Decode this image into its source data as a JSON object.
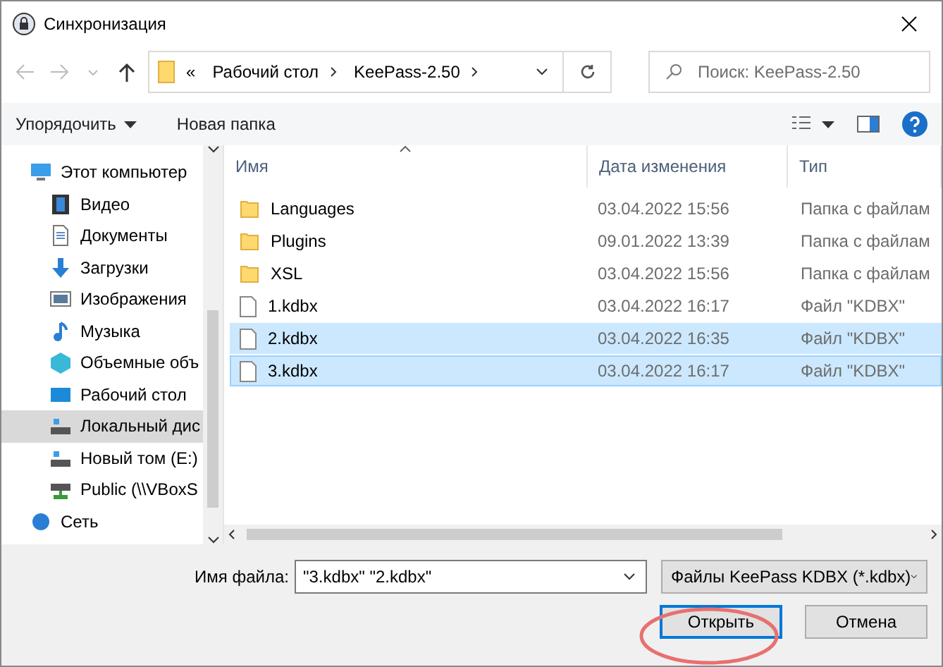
{
  "window": {
    "title": "Синхронизация"
  },
  "address": {
    "overflow": "«",
    "crumbs": [
      "Рабочий стол",
      "KeePass-2.50"
    ]
  },
  "search": {
    "placeholder": "Поиск: KeePass-2.50"
  },
  "toolbar": {
    "organize": "Упорядочить",
    "new_folder": "Новая папка"
  },
  "sidebar": {
    "items": [
      {
        "label": "Этот компьютер",
        "selected": false,
        "children": [
          {
            "label": "Видео",
            "selected": false
          },
          {
            "label": "Документы",
            "selected": false
          },
          {
            "label": "Загрузки",
            "selected": false
          },
          {
            "label": "Изображения",
            "selected": false
          },
          {
            "label": "Музыка",
            "selected": false
          },
          {
            "label": "Объемные объ",
            "selected": false
          },
          {
            "label": "Рабочий стол",
            "selected": false
          },
          {
            "label": "Локальный дис",
            "selected": true
          },
          {
            "label": "Новый том (E:)",
            "selected": false
          },
          {
            "label": "Public (\\\\VBoxS",
            "selected": false
          }
        ]
      },
      {
        "label": "Сеть",
        "selected": false
      }
    ]
  },
  "table": {
    "columns": [
      "Имя",
      "Дата изменения",
      "Тип"
    ],
    "rows": [
      {
        "name": "Languages",
        "kind": "folder",
        "date": "03.04.2022 15:56",
        "type": "Папка с файлам",
        "selected": false,
        "focused": false
      },
      {
        "name": "Plugins",
        "kind": "folder",
        "date": "09.01.2022 13:39",
        "type": "Папка с файлам",
        "selected": false,
        "focused": false
      },
      {
        "name": "XSL",
        "kind": "folder",
        "date": "03.04.2022 15:56",
        "type": "Папка с файлам",
        "selected": false,
        "focused": false
      },
      {
        "name": "1.kdbx",
        "kind": "file",
        "date": "03.04.2022 16:17",
        "type": "Файл \"KDBX\"",
        "selected": false,
        "focused": false
      },
      {
        "name": "2.kdbx",
        "kind": "file",
        "date": "03.04.2022 16:35",
        "type": "Файл \"KDBX\"",
        "selected": true,
        "focused": false
      },
      {
        "name": "3.kdbx",
        "kind": "file",
        "date": "03.04.2022 16:17",
        "type": "Файл \"KDBX\"",
        "selected": true,
        "focused": true
      }
    ]
  },
  "footer": {
    "filename_label": "Имя файла:",
    "filename_value": "\"3.kdbx\" \"2.kdbx\"",
    "filter": "Файлы KeePass KDBX (*.kdbx)",
    "buttons": [
      "Открыть",
      "Отмена"
    ]
  }
}
